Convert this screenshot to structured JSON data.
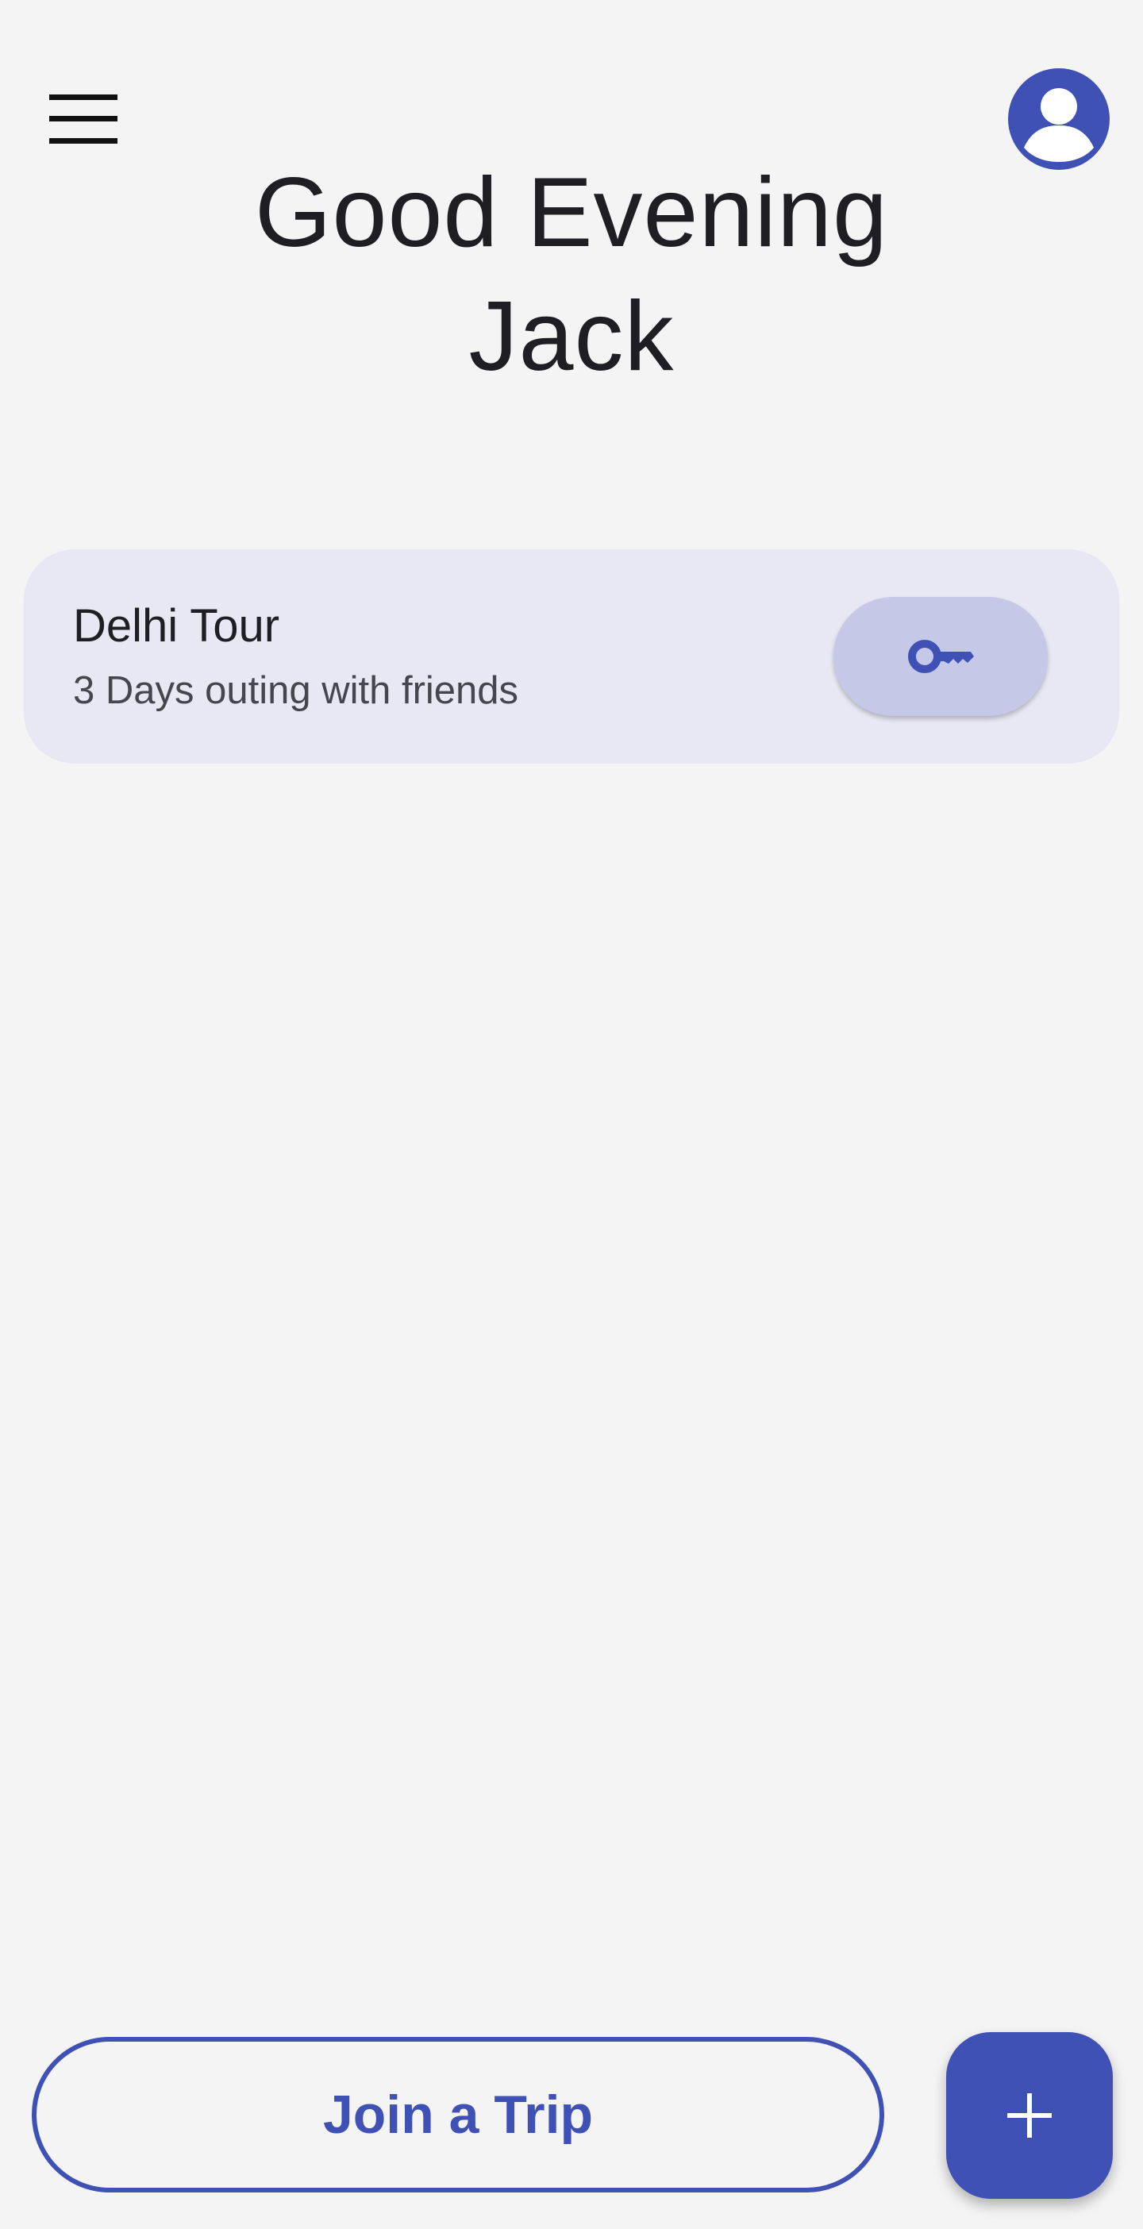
{
  "header": {
    "menu_icon": "menu-icon",
    "profile_icon": "account-circle-icon"
  },
  "greeting": {
    "line1": "Good Evening",
    "line2": "Jack"
  },
  "trips": [
    {
      "title": "Delhi Tour",
      "subtitle": "3 Days outing with friends",
      "action_icon": "key-icon"
    }
  ],
  "footer": {
    "join_label": "Join a Trip",
    "fab_icon": "plus-icon"
  },
  "colors": {
    "primary": "#3f51b5",
    "background": "#f4f4f4",
    "card_background": "#e7e8f4",
    "key_button_background": "#c5c8e7",
    "title_text": "#1f1f23",
    "subtitle_text": "#46464f"
  }
}
